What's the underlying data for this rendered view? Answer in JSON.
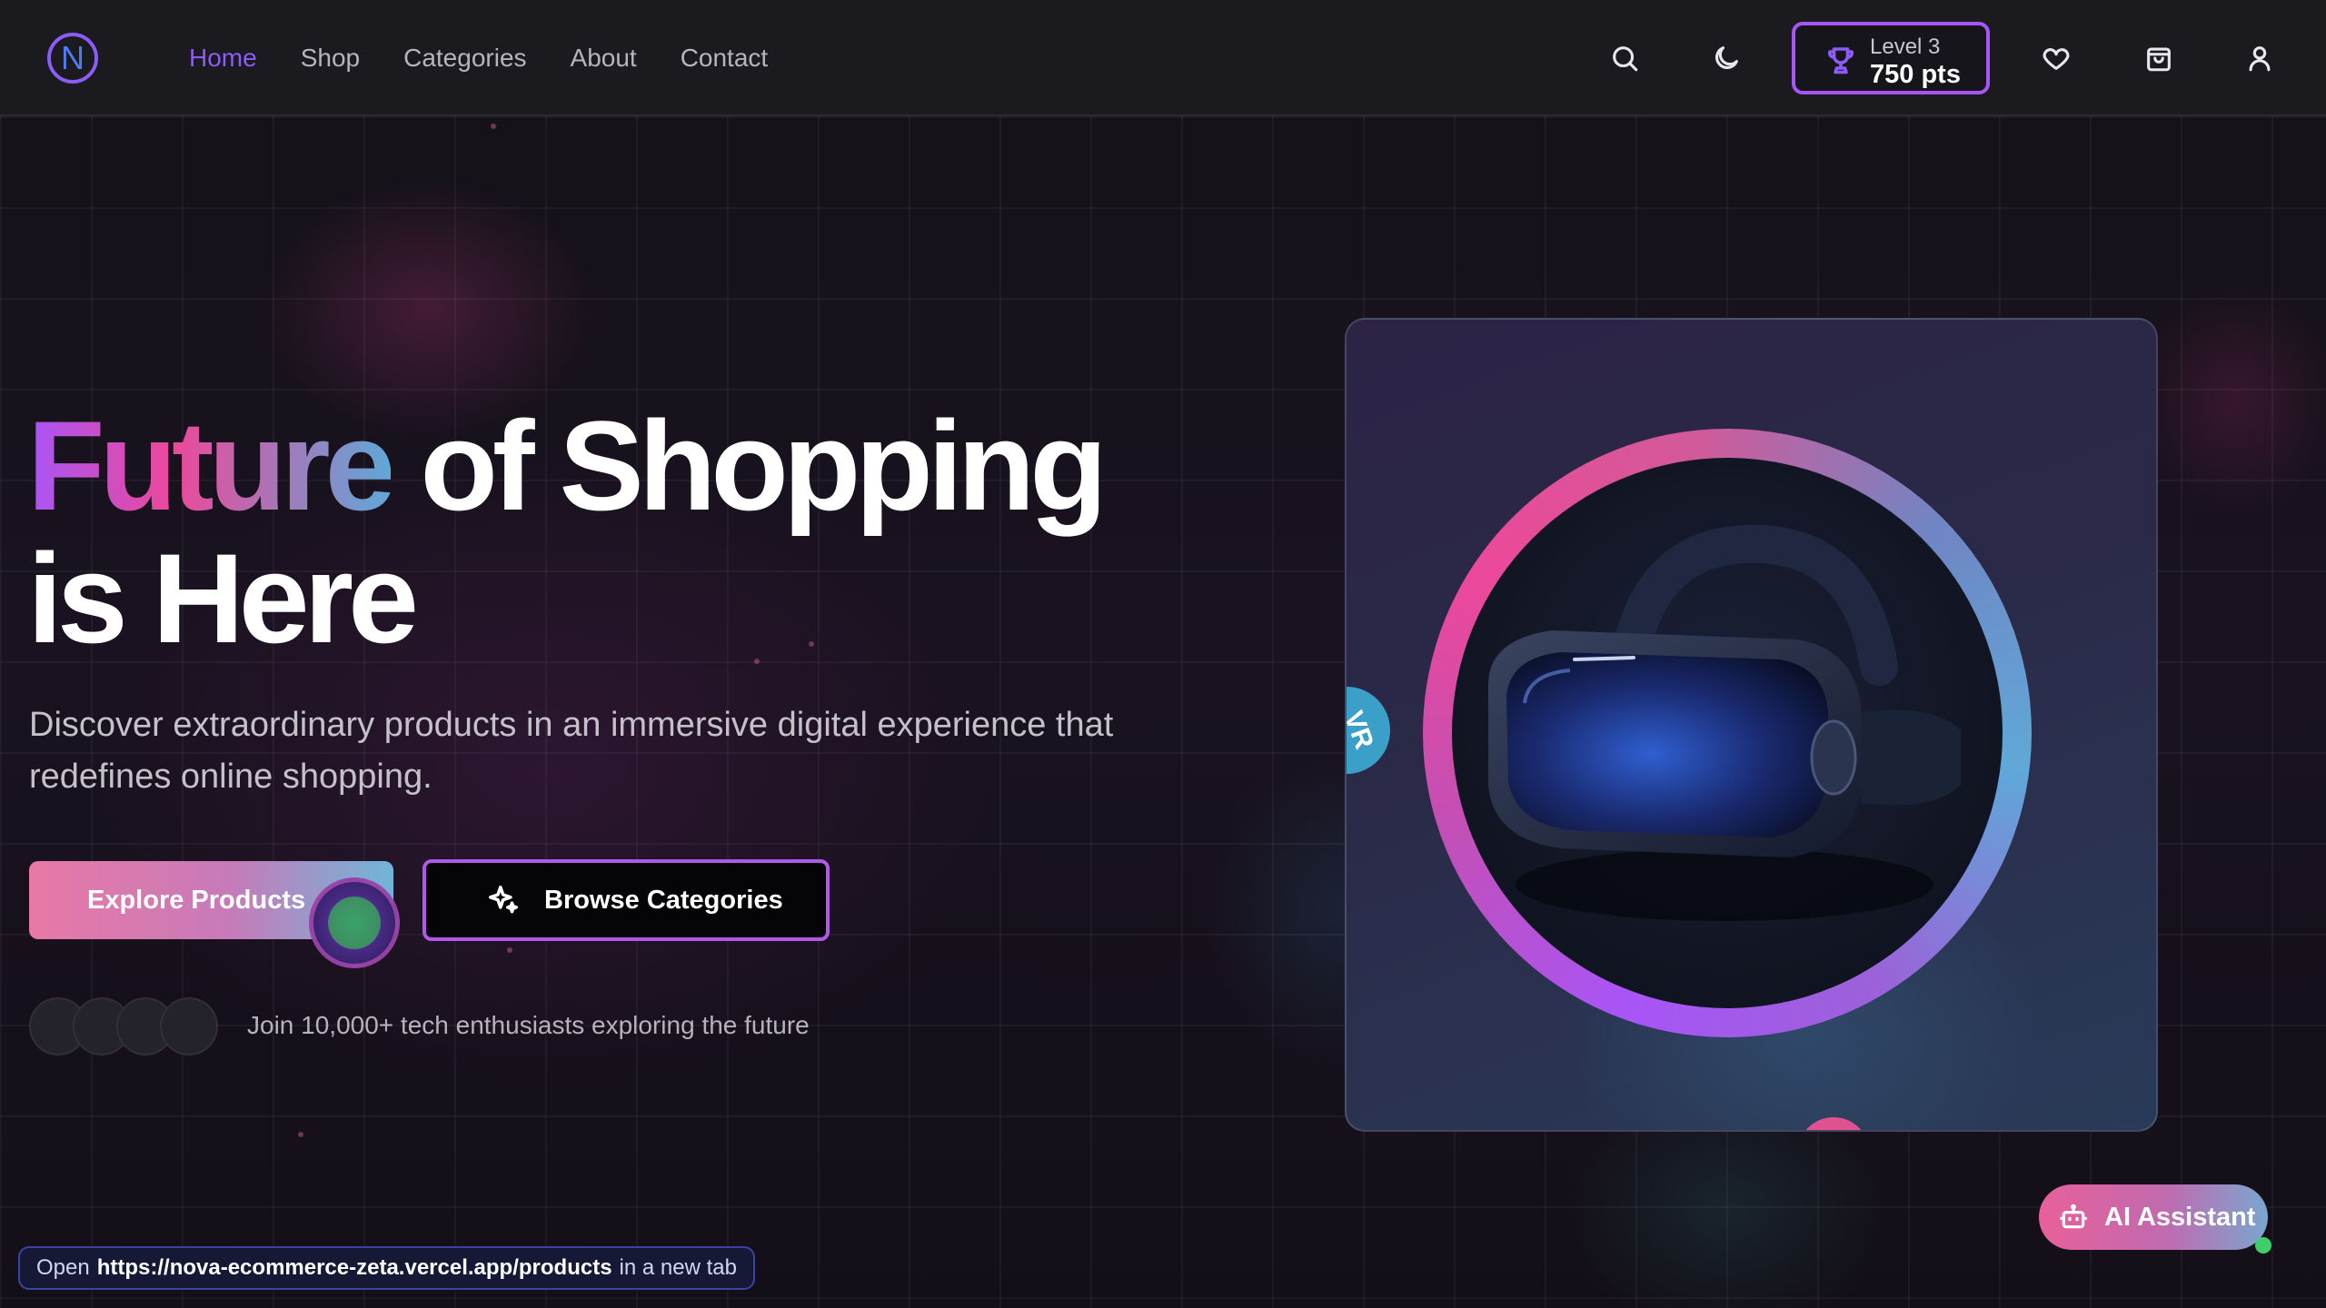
{
  "nav": {
    "logo_letter": "N",
    "items": [
      {
        "label": "Home",
        "active": true
      },
      {
        "label": "Shop",
        "active": false
      },
      {
        "label": "Categories",
        "active": false
      },
      {
        "label": "About",
        "active": false
      },
      {
        "label": "Contact",
        "active": false
      }
    ],
    "icons": [
      "search-icon",
      "moon-icon",
      "heart-icon",
      "shopping-bag-icon",
      "user-icon"
    ],
    "level": {
      "label": "Level 3",
      "points": "750 pts"
    }
  },
  "hero": {
    "title_gradient": "Future",
    "title_rest": " of Shopping",
    "title_line2": "is Here",
    "subtitle": "Discover extraordinary products in an immersive digital experience that redefines online shopping.",
    "explore_label": "Explore Products",
    "browse_label": "Browse Categories",
    "join_text": "Join 10,000+ tech enthusiasts exploring the future"
  },
  "product_card": {
    "badge_label": "VR"
  },
  "assistant": {
    "label": "AI Assistant"
  },
  "status": {
    "prefix": "Open",
    "url": "https://nova-ecommerce-zeta.vercel.app/products",
    "suffix": "in a new tab"
  },
  "colors": {
    "accent_purple": "#8b5cf6",
    "accent_pink": "#ec4899",
    "accent_blue": "#5fa8d8"
  }
}
